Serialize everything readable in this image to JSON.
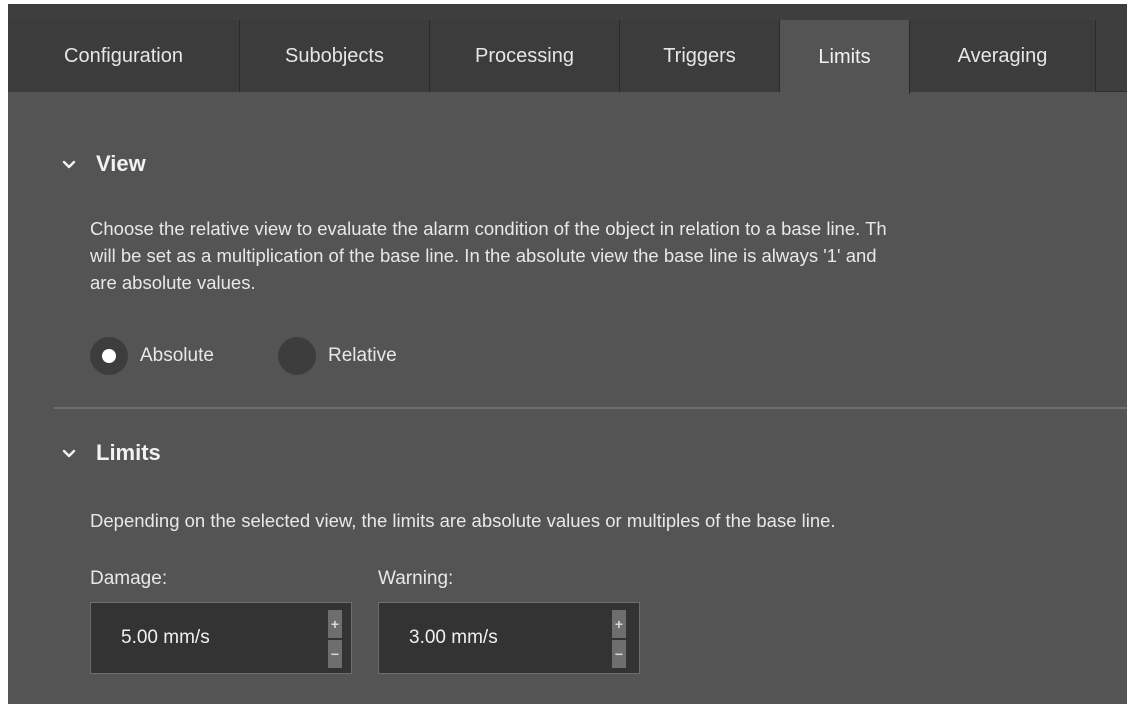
{
  "tabs": [
    {
      "label": "Configuration"
    },
    {
      "label": "Subobjects"
    },
    {
      "label": "Processing"
    },
    {
      "label": "Triggers"
    },
    {
      "label": "Limits"
    },
    {
      "label": "Averaging"
    }
  ],
  "active_tab": "Limits",
  "view_section": {
    "title": "View",
    "description_lines": [
      "Choose the relative view to evaluate the alarm condition of the object in relation to a base line. Th",
      "will be set as a multiplication of the base line. In the absolute view the base line is always '1' and",
      "are absolute values."
    ],
    "options": [
      {
        "label": "Absolute",
        "selected": true
      },
      {
        "label": "Relative",
        "selected": false
      }
    ]
  },
  "limits_section": {
    "title": "Limits",
    "description": "Depending on the selected view, the limits are absolute values or multiples of the base line.",
    "damage": {
      "label": "Damage:",
      "value": "5.00 mm/s"
    },
    "warning": {
      "label": "Warning:",
      "value": "3.00 mm/s"
    },
    "increment_symbol": "+",
    "decrement_symbol": "−"
  },
  "colors": {
    "panel_bg": "#545454",
    "tab_bg": "#3c3c3c",
    "input_bg": "#333333",
    "text": "#e6e6e6"
  },
  "icons": {
    "section_toggle": "chevron-down-icon",
    "radio": "radio-button-icon"
  }
}
